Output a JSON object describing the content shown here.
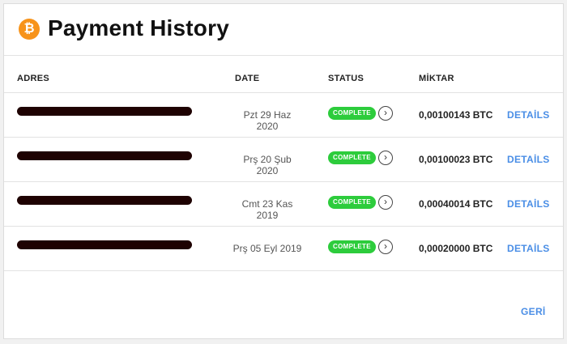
{
  "header": {
    "title": "Payment History",
    "icon_symbol": "₿",
    "icon": "bitcoin-icon",
    "icon_color": "#f7931a"
  },
  "table": {
    "columns": [
      "ADRES",
      "DATE",
      "STATUS",
      "MİKTAR"
    ],
    "rows": [
      {
        "date": "Pzt 29 Haz 2020",
        "status": "COMPLETE",
        "amount": "0,00100143 BTC",
        "action": "DETAİLS"
      },
      {
        "date": "Prş 20 Şub 2020",
        "status": "COMPLETE",
        "amount": "0,00100023 BTC",
        "action": "DETAİLS"
      },
      {
        "date": "Cmt 23 Kas 2019",
        "status": "COMPLETE",
        "amount": "0,00040014 BTC",
        "action": "DETAİLS"
      },
      {
        "date": "Prş 05 Eyl 2019",
        "status": "COMPLETE",
        "amount": "0,00020000 BTC",
        "action": "DETAİLS"
      }
    ]
  },
  "footer": {
    "back_label": "GERİ"
  },
  "colors": {
    "status_green": "#2dcc3c",
    "link_blue": "#4a8ee6",
    "redaction": "#1e0202"
  }
}
